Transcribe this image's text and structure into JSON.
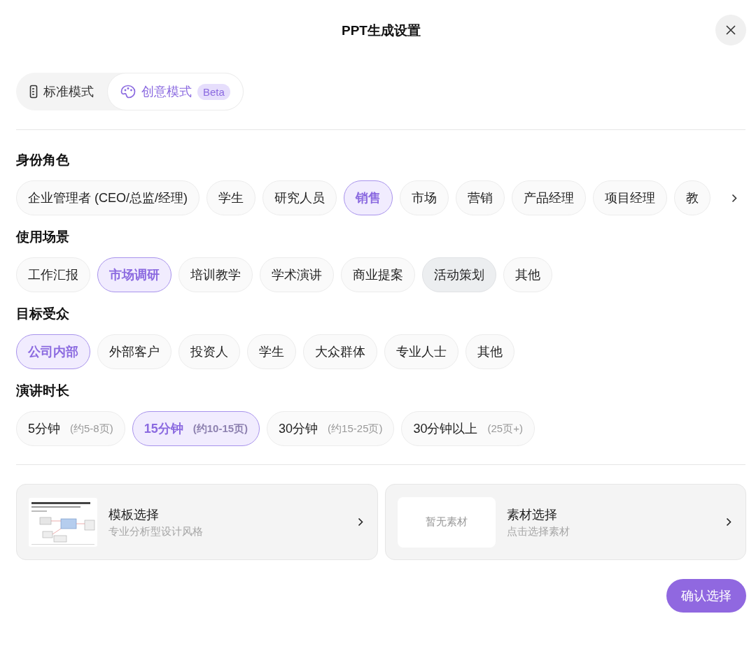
{
  "dialog": {
    "title": "PPT生成设置"
  },
  "modes": [
    {
      "kind": "standard",
      "label": "标准模式",
      "selected": false
    },
    {
      "kind": "creative",
      "label": "创意模式",
      "badge": "Beta",
      "selected": true
    }
  ],
  "sections": [
    {
      "title": "身份角色",
      "scrollable": true,
      "options": [
        {
          "label": "企业管理者 (CEO/总监/经理)",
          "selected": false,
          "hovered": false
        },
        {
          "label": "学生",
          "selected": false,
          "hovered": false
        },
        {
          "label": "研究人员",
          "selected": false,
          "hovered": false
        },
        {
          "label": "销售",
          "selected": true,
          "hovered": false
        },
        {
          "label": "市场",
          "selected": false,
          "hovered": false
        },
        {
          "label": "营销",
          "selected": false,
          "hovered": false
        },
        {
          "label": "产品经理",
          "selected": false,
          "hovered": false
        },
        {
          "label": "项目经理",
          "selected": false,
          "hovered": false
        },
        {
          "label": "教",
          "selected": false,
          "hovered": false
        }
      ]
    },
    {
      "title": "使用场景",
      "scrollable": false,
      "options": [
        {
          "label": "工作汇报",
          "selected": false,
          "hovered": false
        },
        {
          "label": "市场调研",
          "selected": true,
          "hovered": false
        },
        {
          "label": "培训教学",
          "selected": false,
          "hovered": false
        },
        {
          "label": "学术演讲",
          "selected": false,
          "hovered": false
        },
        {
          "label": "商业提案",
          "selected": false,
          "hovered": false
        },
        {
          "label": "活动策划",
          "selected": false,
          "hovered": true
        },
        {
          "label": "其他",
          "selected": false,
          "hovered": false
        }
      ]
    },
    {
      "title": "目标受众",
      "scrollable": false,
      "options": [
        {
          "label": "公司内部",
          "selected": true,
          "hovered": false
        },
        {
          "label": "外部客户",
          "selected": false,
          "hovered": false
        },
        {
          "label": "投资人",
          "selected": false,
          "hovered": false
        },
        {
          "label": "学生",
          "selected": false,
          "hovered": false
        },
        {
          "label": "大众群体",
          "selected": false,
          "hovered": false
        },
        {
          "label": "专业人士",
          "selected": false,
          "hovered": false
        },
        {
          "label": "其他",
          "selected": false,
          "hovered": false
        }
      ]
    },
    {
      "title": "演讲时长",
      "scrollable": false,
      "options": [
        {
          "label": "5分钟",
          "note": "(约5-8页)",
          "selected": false,
          "hovered": false
        },
        {
          "label": "15分钟",
          "note": "(约10-15页)",
          "selected": true,
          "hovered": false
        },
        {
          "label": "30分钟",
          "note": "(约15-25页)",
          "selected": false,
          "hovered": false
        },
        {
          "label": "30分钟以上",
          "note": "(25页+)",
          "selected": false,
          "hovered": false
        }
      ]
    }
  ],
  "cards": [
    {
      "kind": "template",
      "title": "模板选择",
      "subtitle": "专业分析型设计风格"
    },
    {
      "kind": "material",
      "title": "素材选择",
      "subtitle": "点击选择素材",
      "empty_text": "暂无素材"
    }
  ],
  "confirm": "确认选择"
}
